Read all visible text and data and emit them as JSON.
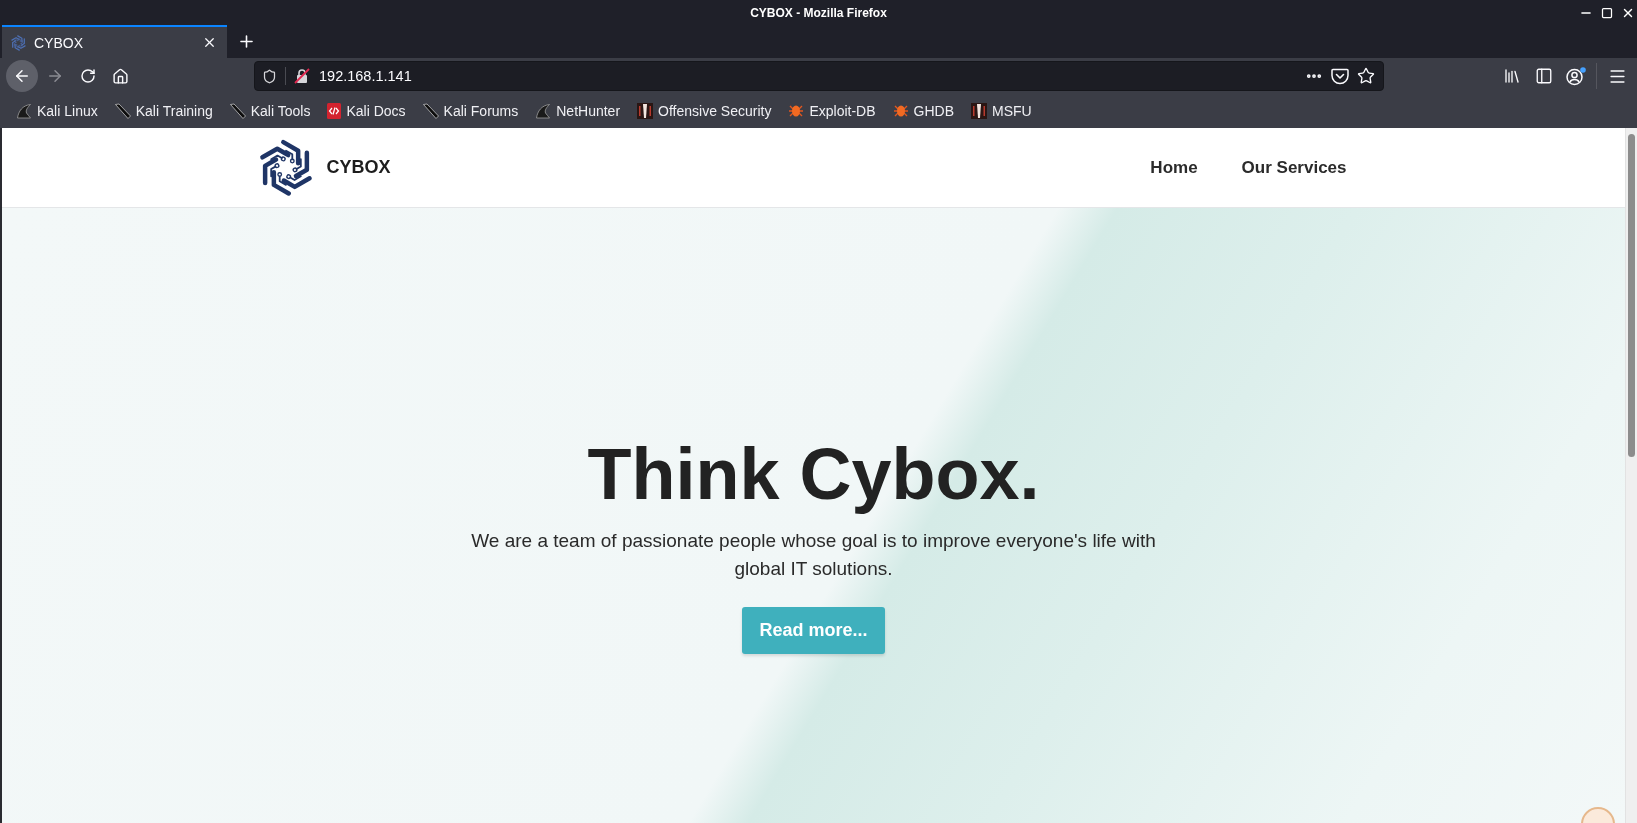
{
  "window": {
    "title": "CYBOX - Mozilla Firefox"
  },
  "tabs": [
    {
      "title": "CYBOX",
      "selected": true
    }
  ],
  "toolbar": {
    "back": {
      "disabled": false
    },
    "forward": {
      "disabled": true
    },
    "url": "192.168.1.141"
  },
  "bookmarks": [
    {
      "label": "Kali Linux",
      "kind": "dragon"
    },
    {
      "label": "Kali Training",
      "kind": "knife"
    },
    {
      "label": "Kali Tools",
      "kind": "knife"
    },
    {
      "label": "Kali Docs",
      "kind": "doc"
    },
    {
      "label": "Kali Forums",
      "kind": "knife"
    },
    {
      "label": "NetHunter",
      "kind": "dragon"
    },
    {
      "label": "Offensive Security",
      "kind": "tile"
    },
    {
      "label": "Exploit-DB",
      "kind": "bug"
    },
    {
      "label": "GHDB",
      "kind": "bug"
    },
    {
      "label": "MSFU",
      "kind": "tile"
    }
  ],
  "site": {
    "brand": "CYBOX",
    "nav": [
      "Home",
      "Our Services"
    ],
    "hero": {
      "heading": "Think Cybox.",
      "text": "We are a team of passionate people whose goal is to improve everyone's life with global IT solutions.",
      "button": "Read more..."
    }
  }
}
